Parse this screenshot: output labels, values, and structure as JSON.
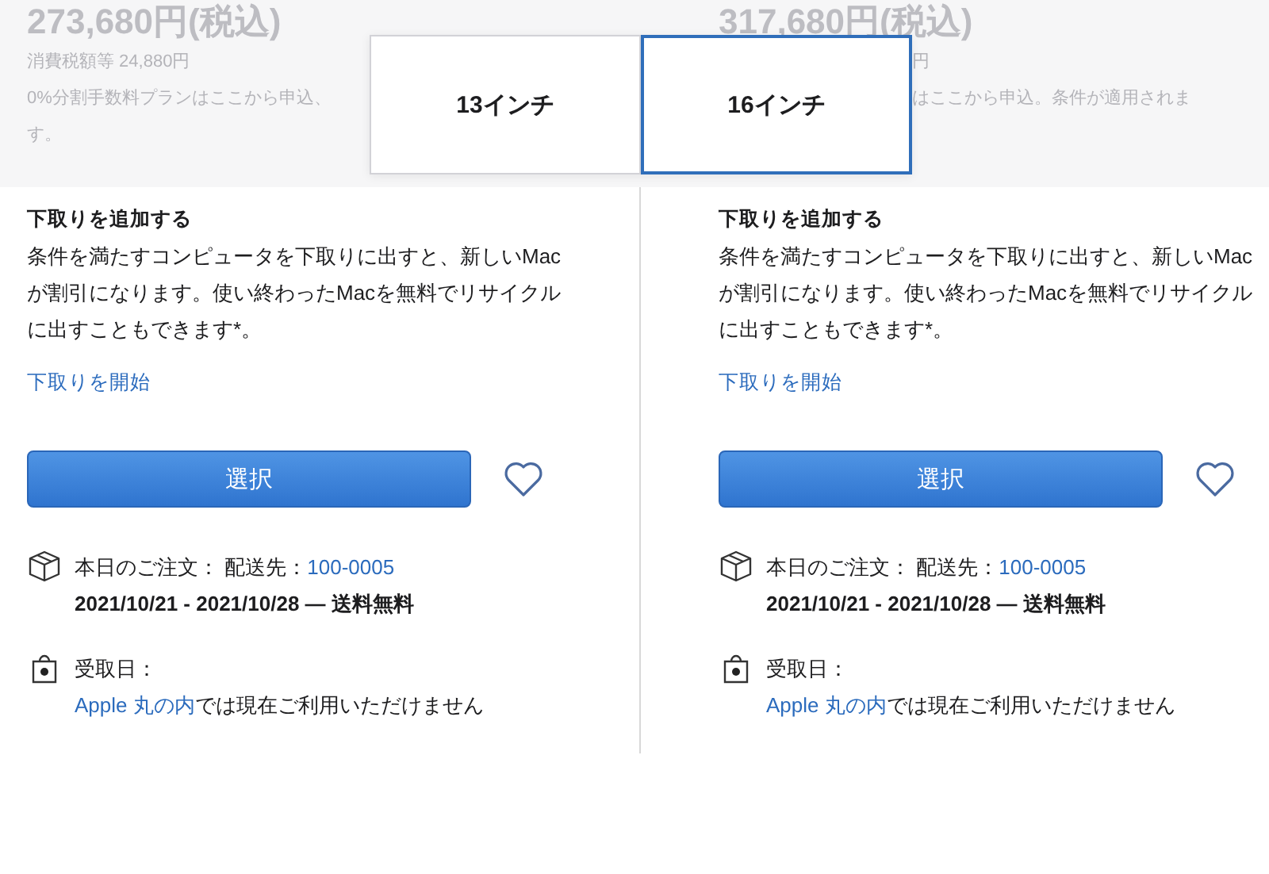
{
  "price_band": [
    {
      "price": "273,680円(税込)",
      "lines": [
        "消費税額等 24,880円",
        "0%分割手数料プランはここから申込、",
        "す。"
      ]
    },
    {
      "price": "317,680円(税込)",
      "lines": [
        "円",
        "はここから申込。条件が適用されま"
      ]
    }
  ],
  "size_selector": [
    {
      "label": "13インチ",
      "selected": false
    },
    {
      "label": "16インチ",
      "selected": true
    }
  ],
  "columns": [
    {
      "trade_in_title": "下取りを追加する",
      "trade_in_text": [
        "条件を満たすコンピュータを下取りに出すと、新しいMac",
        "が割引になります。使い終わったMacを無料でリサイクル",
        "に出すこともできます*。"
      ],
      "trade_in_link": "下取りを開始",
      "select_button": "選択",
      "delivery": {
        "label": "本日のご注文：",
        "destination": "配送先：",
        "postal_code": "100-0005",
        "dates": "2021/10/21 - 2021/10/28 — 送料無料"
      },
      "pickup": {
        "label": "受取日：",
        "store": "Apple 丸の内",
        "note": "では現在ご利用いただけません"
      }
    },
    {
      "trade_in_title": "下取りを追加する",
      "trade_in_text": [
        "条件を満たすコンピュータを下取りに出すと、新しいMac",
        "が割引になります。使い終わったMacを無料でリサイクル",
        "に出すこともできます*。"
      ],
      "trade_in_link": "下取りを開始",
      "select_button": "選択",
      "delivery": {
        "label": "本日のご注文：",
        "destination": "配送先：",
        "postal_code": "100-0005",
        "dates": "2021/10/21 - 2021/10/28 — 送料無料"
      },
      "pickup": {
        "label": "受取日：",
        "store": "Apple 丸の内",
        "note": "では現在ご利用いただけません"
      }
    }
  ]
}
